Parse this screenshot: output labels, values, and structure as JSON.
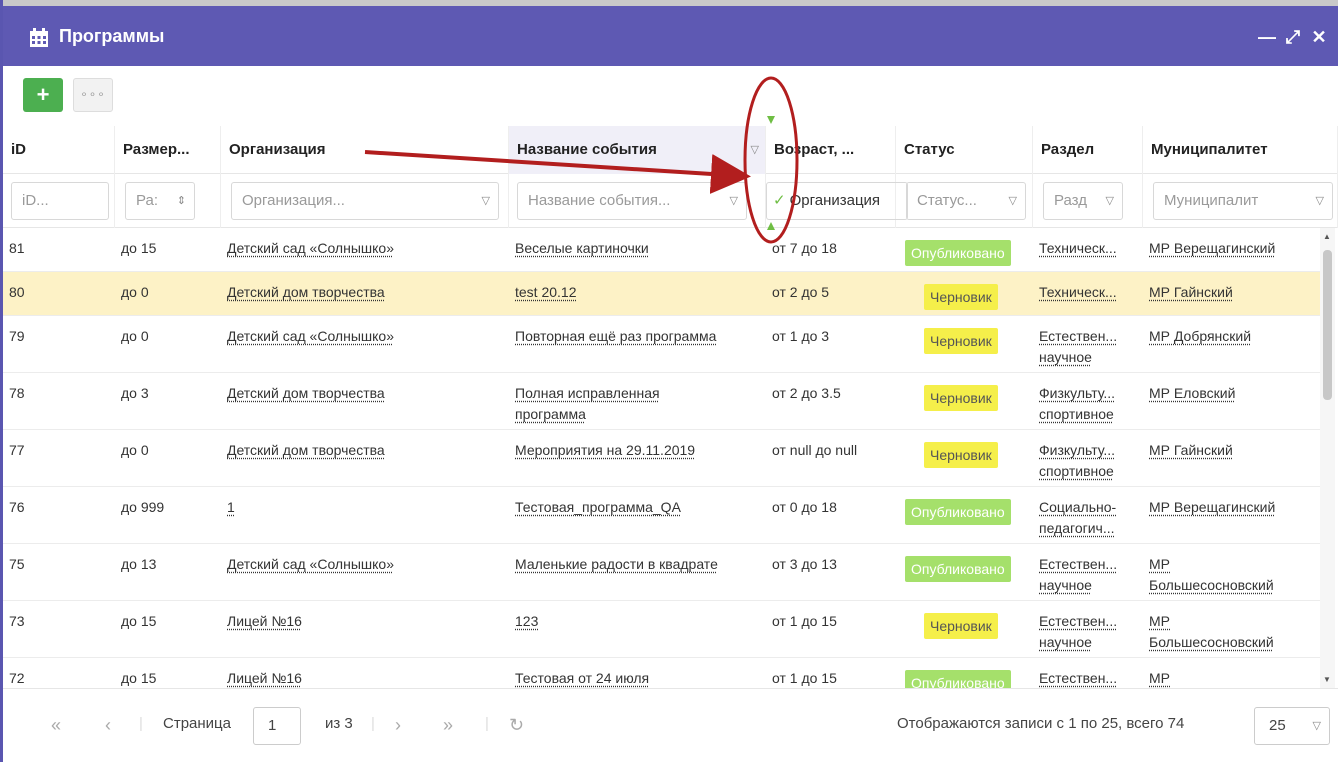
{
  "window": {
    "title": "Программы",
    "controls": [
      "—",
      "⤢",
      "✕"
    ]
  },
  "toolbar": {
    "add_label": "+",
    "more_label": "∘∘∘"
  },
  "columns": [
    {
      "key": "id",
      "header": "iD",
      "filter": "iD..."
    },
    {
      "key": "size",
      "header": "Размер...",
      "filter": "Ра:"
    },
    {
      "key": "org",
      "header": "Организация",
      "filter": "Организация..."
    },
    {
      "key": "event",
      "header": "Название события",
      "filter": "Название события..."
    },
    {
      "key": "age",
      "header": "Возраст, ...",
      "filter": "Организация"
    },
    {
      "key": "status",
      "header": "Статус",
      "filter": "Статус..."
    },
    {
      "key": "section",
      "header": "Раздел",
      "filter": "Разд"
    },
    {
      "key": "muni",
      "header": "Муниципалитет",
      "filter": "Муниципалит"
    }
  ],
  "rows": [
    {
      "id": "81",
      "size": "до 15",
      "org": "Детский сад «Солнышко»",
      "event": [
        "Веселые картиночки"
      ],
      "age": "от 7 до 18",
      "status": "Опубликовано",
      "section": [
        "Техническ..."
      ],
      "muni": [
        "МР Верещагинский"
      ]
    },
    {
      "id": "80",
      "size": "до 0",
      "org": "Детский дом творчества",
      "event": [
        "test 20.12"
      ],
      "age": "от 2 до 5",
      "status": "Черновик",
      "section": [
        "Техническ..."
      ],
      "muni": [
        "МР Гайнский"
      ]
    },
    {
      "id": "79",
      "size": "до 0",
      "org": "Детский сад «Солнышко»",
      "event": [
        "Повторная ещё раз программа"
      ],
      "age": "от 1 до 3",
      "status": "Черновик",
      "section": [
        "Естествен...",
        "научное"
      ],
      "muni": [
        "МР Добрянский"
      ]
    },
    {
      "id": "78",
      "size": "до 3",
      "org": "Детский дом творчества",
      "event": [
        "Полная исправленная",
        "программа"
      ],
      "age": "от 2 до 3.5",
      "status": "Черновик",
      "section": [
        "Физкульту...",
        "спортивное"
      ],
      "muni": [
        "МР Еловский"
      ]
    },
    {
      "id": "77",
      "size": "до 0",
      "org": "Детский дом творчества",
      "event": [
        "Мероприятия на 29.11.2019"
      ],
      "age": "от null до null",
      "status": "Черновик",
      "section": [
        "Физкульту...",
        "спортивное"
      ],
      "muni": [
        "МР Гайнский"
      ]
    },
    {
      "id": "76",
      "size": "до 999",
      "org": "1",
      "event": [
        "Тестовая_программа_QA"
      ],
      "age": "от 0 до 18",
      "status": "Опубликовано",
      "section": [
        "Социально-",
        "педагогич..."
      ],
      "muni": [
        "МР Верещагинский"
      ]
    },
    {
      "id": "75",
      "size": "до 13",
      "org": "Детский сад «Солнышко»",
      "event": [
        "Маленькие радости в квадрате"
      ],
      "age": "от 3 до 13",
      "status": "Опубликовано",
      "section": [
        "Естествен...",
        "научное"
      ],
      "muni": [
        "МР",
        "Большесосновский"
      ]
    },
    {
      "id": "73",
      "size": "до 15",
      "org": "Лицей №16",
      "event": [
        "123"
      ],
      "age": "от 1 до 15",
      "status": "Черновик",
      "section": [
        "Естествен...",
        "научное"
      ],
      "muni": [
        "МР",
        "Большесосновский"
      ]
    },
    {
      "id": "72",
      "size": "до 15",
      "org": "Лицей №16",
      "event": [
        "Тестовая от 24 июля"
      ],
      "age": "от 1 до 15",
      "status": "Опубликовано",
      "section": [
        "Естествен..."
      ],
      "muni": [
        "МР"
      ]
    }
  ],
  "selected_row_id": "80",
  "pager": {
    "page_label": "Страница",
    "page_value": "1",
    "of_label": "из 3",
    "summary": "Отображаются записи с 1 по 25, всего 74",
    "page_size": "25"
  },
  "colors": {
    "titlebar": "#5e59b3",
    "add": "#4caf50",
    "published": "#a5e06b",
    "draft": "#f5ef4a",
    "selected": "#fdf2c6",
    "annotation": "#b21e1e"
  }
}
